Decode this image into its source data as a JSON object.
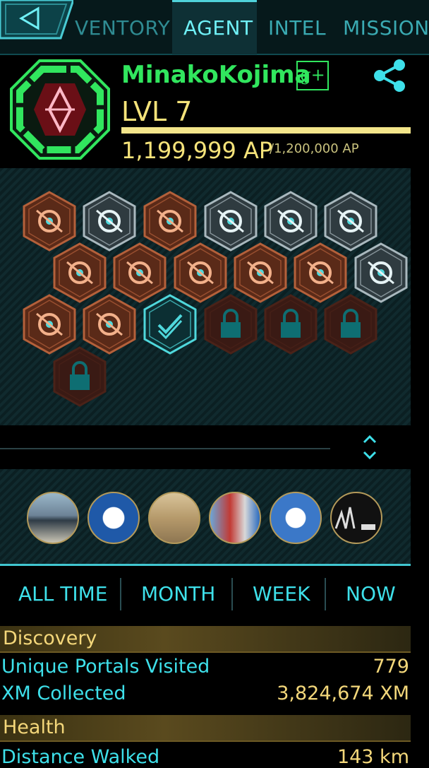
{
  "nav": {
    "tabs": [
      "VENTORY",
      "AGENT",
      "INTEL",
      "MISSIONS"
    ],
    "active": "AGENT"
  },
  "agent": {
    "name": "MinakoKojima",
    "gplus": "g+",
    "level": "LVL 7",
    "level_progress": 0.999,
    "ap": "1,199,999 AP",
    "ap_max": "/1,200,000 AP"
  },
  "badges": [
    {
      "name": "badge-seer",
      "style": "bronze"
    },
    {
      "name": "badge-camera",
      "style": "silver"
    },
    {
      "name": "badge-hacker",
      "style": "bronze"
    },
    {
      "name": "badge-builder",
      "style": "silver"
    },
    {
      "name": "badge-connector",
      "style": "silver"
    },
    {
      "name": "badge-trekker",
      "style": "silver"
    },
    {
      "name": "badge-explorer",
      "style": "bronze"
    },
    {
      "name": "badge-mind-controller",
      "style": "bronze"
    },
    {
      "name": "badge-liberator",
      "style": "bronze"
    },
    {
      "name": "badge-pioneer",
      "style": "bronze"
    },
    {
      "name": "badge-engineer",
      "style": "bronze"
    },
    {
      "name": "badge-purifier",
      "style": "silver"
    },
    {
      "name": "badge-illuminator",
      "style": "bronze"
    },
    {
      "name": "badge-recharger",
      "style": "bronze"
    },
    {
      "name": "badge-verified",
      "style": "teal"
    },
    {
      "name": "badge-locked-1",
      "style": "locked"
    },
    {
      "name": "badge-locked-2",
      "style": "locked"
    },
    {
      "name": "badge-locked-3",
      "style": "locked"
    },
    {
      "name": "badge-locked-4",
      "style": "locked"
    }
  ],
  "time_tabs": [
    "ALL TIME",
    "MONTH",
    "WEEK",
    "NOW"
  ],
  "stats": {
    "discovery_header": "Discovery",
    "unique_portals_label": "Unique Portals Visited",
    "unique_portals_value": "779",
    "xm_label": "XM Collected",
    "xm_value": "3,824,674 XM",
    "health_header": "Health",
    "distance_label": "Distance Walked",
    "distance_value": "143 km"
  },
  "colors": {
    "accent": "#3ee0ea",
    "enlightened_green": "#31e65e",
    "gold": "#f5e37a"
  }
}
